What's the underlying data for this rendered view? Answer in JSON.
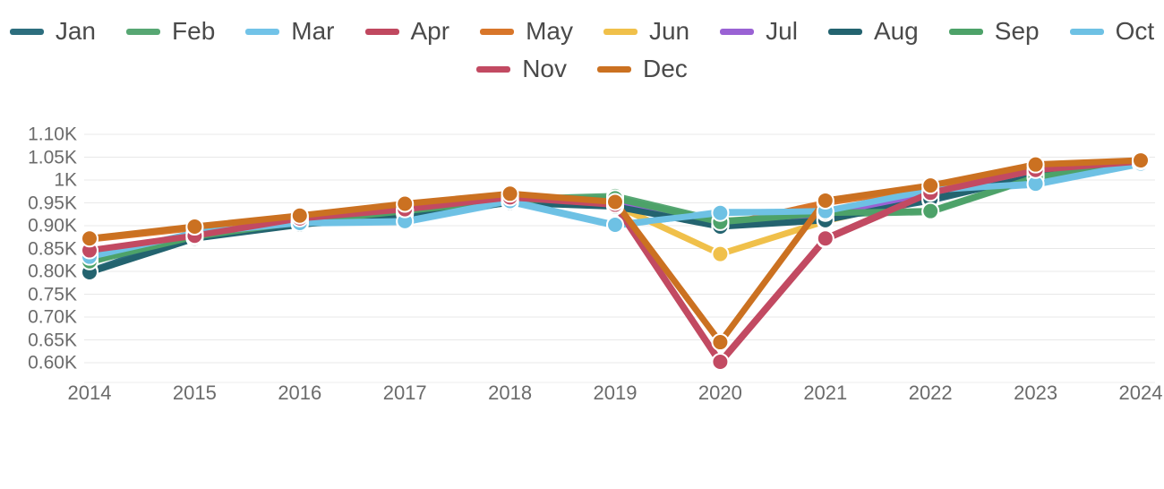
{
  "chart_data": {
    "type": "line",
    "title": "",
    "subtitle": "",
    "xlabel": "",
    "ylabel": "",
    "grid": true,
    "legend_position": "top",
    "categories": [
      "2014",
      "2015",
      "2016",
      "2017",
      "2018",
      "2019",
      "2020",
      "2021",
      "2022",
      "2023",
      "2024"
    ],
    "x": [
      2014,
      2015,
      2016,
      2017,
      2018,
      2019,
      2020,
      2021,
      2022,
      2023,
      2024
    ],
    "ylim": [
      600,
      1100
    ],
    "ytick_values": [
      1100,
      1050,
      1000,
      950,
      900,
      850,
      800,
      750,
      700,
      650,
      600
    ],
    "ytick_labels": [
      "1.10K",
      "1.05K",
      "1K",
      "0.95K",
      "0.90K",
      "0.85K",
      "0.80K",
      "0.75K",
      "0.70K",
      "0.65K",
      "0.60K"
    ],
    "xtick_labels": [
      "2014",
      "2015",
      "2016",
      "2017",
      "2018",
      "2019",
      "2020",
      "2021",
      "2022",
      "2023",
      "2024"
    ],
    "series": [
      {
        "name": "Jan",
        "color": "#2d6e7e",
        "values": [
          800,
          880,
          908,
          930,
          955,
          945,
          900,
          915,
          955,
          1010,
          1040
        ]
      },
      {
        "name": "Feb",
        "color": "#57a773",
        "values": [
          820,
          880,
          912,
          935,
          958,
          965,
          910,
          925,
          930,
          1005,
          1038
        ]
      },
      {
        "name": "Mar",
        "color": "#72c3e8",
        "values": [
          830,
          882,
          905,
          908,
          952,
          900,
          930,
          930,
          975,
          990,
          1035
        ]
      },
      {
        "name": "Apr",
        "color": "#c0485f",
        "values": [
          845,
          875,
          915,
          935,
          960,
          945,
          600,
          870,
          970,
          1020,
          1040
        ]
      },
      {
        "name": "May",
        "color": "#d8762a",
        "values": [
          870,
          895,
          920,
          945,
          968,
          950,
          900,
          950,
          985,
          1030,
          1042
        ]
      },
      {
        "name": "Jun",
        "color": "#f0c04a",
        "values": [
          838,
          878,
          910,
          928,
          955,
          945,
          838,
          910,
          965,
          1012,
          1036
        ]
      },
      {
        "name": "Jul",
        "color": "#9a62d4",
        "values": [
          828,
          878,
          906,
          930,
          953,
          948,
          905,
          922,
          968,
          1016,
          1042
        ]
      },
      {
        "name": "Aug",
        "color": "#23636f",
        "values": [
          798,
          872,
          902,
          925,
          950,
          942,
          898,
          912,
          958,
          1008,
          1044
        ]
      },
      {
        "name": "Sep",
        "color": "#4da269",
        "values": [
          822,
          876,
          908,
          932,
          956,
          960,
          908,
          928,
          932,
          1006,
          1038
        ]
      },
      {
        "name": "Oct",
        "color": "#6ec1e4",
        "values": [
          832,
          884,
          906,
          910,
          954,
          902,
          928,
          932,
          978,
          992,
          1036
        ]
      },
      {
        "name": "Nov",
        "color": "#c24a62",
        "values": [
          846,
          878,
          916,
          936,
          962,
          946,
          602,
          872,
          972,
          1022,
          1041
        ]
      },
      {
        "name": "Dec",
        "color": "#cb7121",
        "values": [
          872,
          898,
          922,
          948,
          970,
          952,
          645,
          955,
          988,
          1034,
          1043
        ]
      }
    ]
  },
  "legend": {
    "rows": [
      [
        "Jan",
        "Feb",
        "Mar",
        "Apr",
        "May",
        "Jun",
        "Jul",
        "Aug",
        "Sep",
        "Oct"
      ],
      [
        "Nov",
        "Dec"
      ]
    ]
  }
}
